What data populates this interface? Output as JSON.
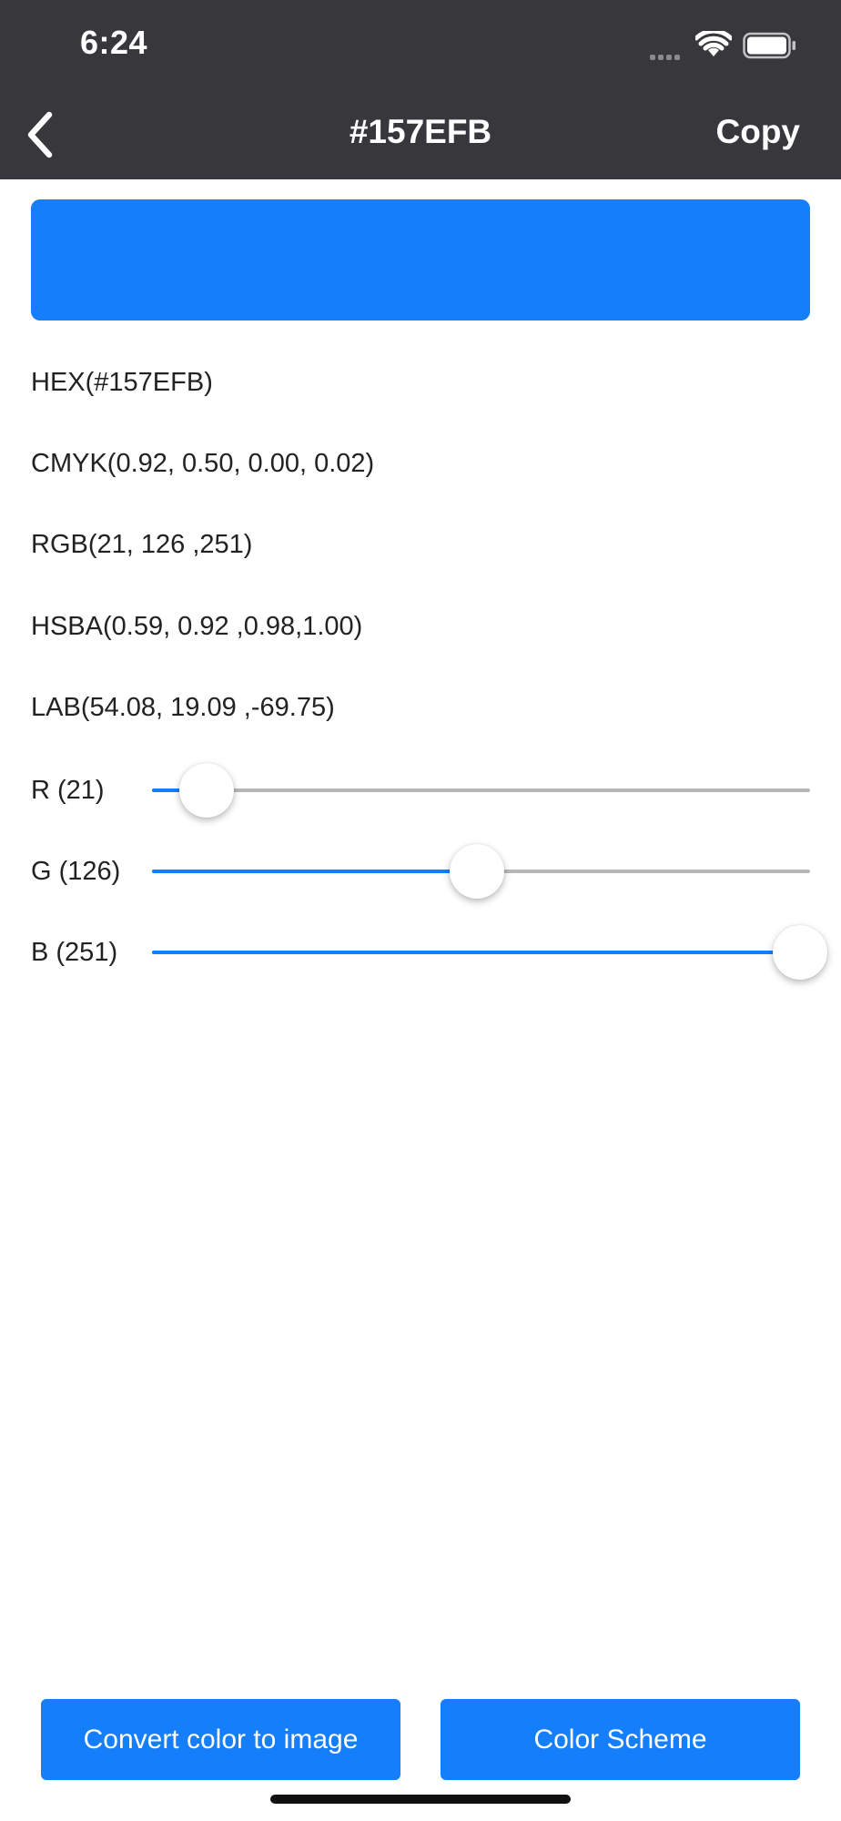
{
  "status_bar": {
    "time": "6:24"
  },
  "nav": {
    "title": "#157EFB",
    "copy_label": "Copy"
  },
  "colors": {
    "accent": "#157EFB",
    "nav_background": "#38373C",
    "track": "#B7B7B7"
  },
  "color_info": {
    "hex": "HEX(#157EFB)",
    "cmyk": "CMYK(0.92, 0.50, 0.00, 0.02)",
    "rgb": "RGB(21, 126 ,251)",
    "hsba": "HSBA(0.59, 0.92 ,0.98,1.00)",
    "lab": "LAB(54.08, 19.09 ,-69.75)"
  },
  "sliders": [
    {
      "label": "R (21)",
      "value": 21,
      "max": 255
    },
    {
      "label": "G (126)",
      "value": 126,
      "max": 255
    },
    {
      "label": "B (251)",
      "value": 251,
      "max": 255
    }
  ],
  "buttons": {
    "convert_label": "Convert color to image",
    "scheme_label": "Color Scheme"
  },
  "icons": {
    "back": "chevron-left-icon",
    "wifi": "wifi-icon",
    "battery": "battery-icon",
    "signal": "cellular-signal-icon"
  }
}
